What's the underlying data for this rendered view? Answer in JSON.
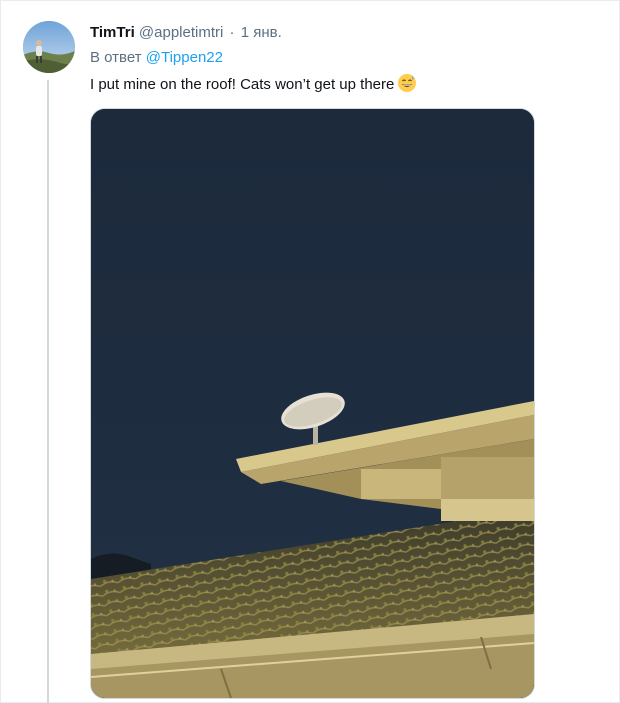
{
  "tweet": {
    "display_name": "TimTri",
    "handle": "@appletimtri",
    "separator": "·",
    "date": "1 янв.",
    "reply_prefix": "В ответ",
    "reply_to": "@Tippen22",
    "text": "I put mine on the roof! Cats won’t get up there",
    "emoji": "grinning-sweat-emoji"
  },
  "media": {
    "type": "photo",
    "subject": "satellite-dish-on-roof"
  },
  "colors": {
    "link": "#1da1f2",
    "secondary_text": "#5b7083",
    "primary_text": "#0f1419"
  }
}
